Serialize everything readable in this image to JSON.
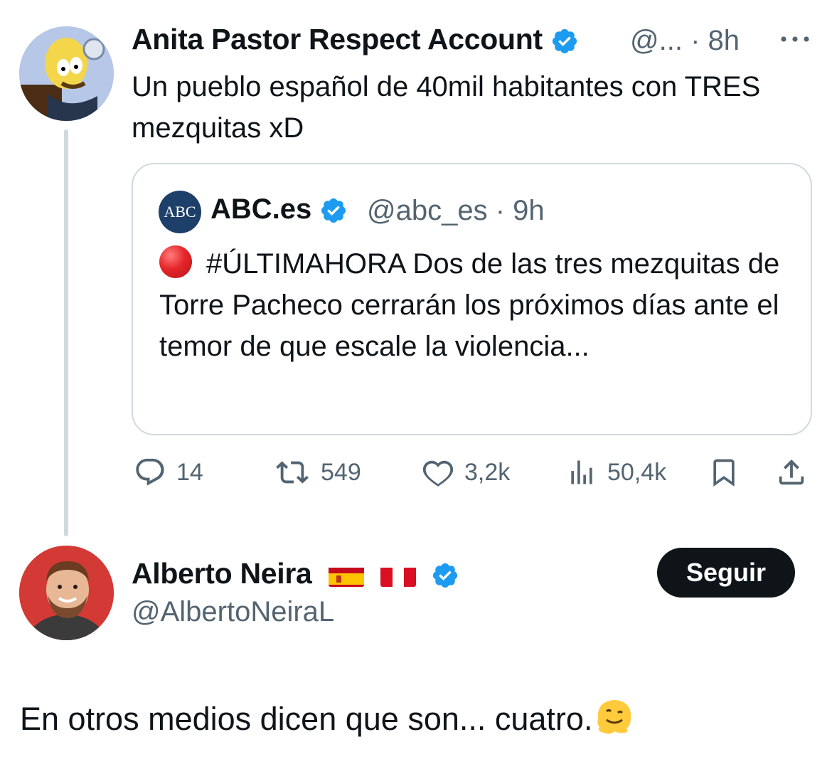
{
  "tweet": {
    "author": {
      "name": "Anita Pastor Respect Account",
      "handle": "@...",
      "time": "· 8h",
      "verified": true
    },
    "text": "Un pueblo español de 40mil habitantes con TRES mezquitas xD",
    "more_icon": "more-horizontal-icon",
    "quote": {
      "logo_text": "ABC",
      "name": "ABC.es",
      "handle": "@abc_es",
      "time": "· 9h",
      "verified": true,
      "text": "#ÚLTIMAHORA Dos de las tres mezquitas de Torre Pacheco cerrarán los próximos días ante el temor de que escale la violencia..."
    },
    "stats": {
      "replies": "14",
      "retweets": "549",
      "likes": "3,2k",
      "views": "50,4k"
    }
  },
  "reply": {
    "author": {
      "name": "Alberto Neira",
      "handle": "@AlbertoNeiraL",
      "verified": true,
      "flags": [
        "spain-flag",
        "peru-flag"
      ]
    },
    "follow_label": "Seguir",
    "text": "En otros medios dicen que son... cuatro."
  },
  "colors": {
    "verified_blue": "#1d9bf0",
    "secondary_text": "#536471",
    "border": "#cfd9de",
    "follow_button": "#0f1419"
  }
}
